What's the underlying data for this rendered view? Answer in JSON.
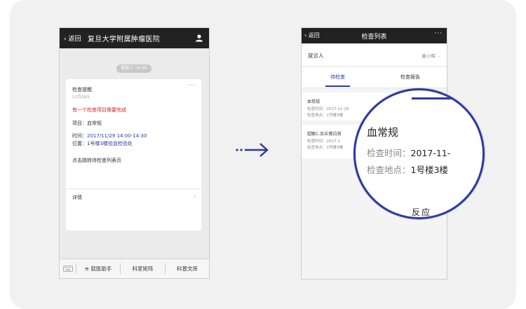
{
  "colors": {
    "accent": "#2d3a9b",
    "alert": "#e02020",
    "header": "#222222"
  },
  "phone1": {
    "header": {
      "back_label": "返回",
      "title": "复旦大学附属肿瘤医院",
      "user_icon": "user-icon"
    },
    "date_badge": "星期三 19:30",
    "message": {
      "title": "检查提醒",
      "date": "11月29日",
      "alert": "有一个检查项目需要完成",
      "item_label": "项目：",
      "item_value": "血常规",
      "time_label": "时间：",
      "time_value": "2017/11/29  14:00-14:30",
      "place_label": "位置：",
      "place_value": "1号楼3楼验血检验处",
      "hint": "点击跳转待检查列表页",
      "detail_label": "详情"
    },
    "bottom_tabs": [
      "就医助手",
      "科室矩阵",
      "科普文库"
    ]
  },
  "phone2": {
    "header": {
      "back_label": "返回",
      "title": "检查列表"
    },
    "patient_label": "就诊人",
    "patient_name": "秦小辉",
    "tabs": [
      "待检查",
      "检查报告"
    ],
    "items": [
      {
        "name": "血常规",
        "time": "检查时间：2017-11-29",
        "place": "检查地点：1号楼3楼"
      },
      {
        "name": "超敏C-反应蛋白测",
        "time": "检查时间：2017-1",
        "place": "检查地点：1号楼3楼"
      }
    ]
  },
  "magnifier": {
    "title": "血常规",
    "time_label": "检查时间：",
    "time_value": "2017-11-",
    "place_label": "检查地点：",
    "place_value": "1号楼3楼",
    "next_fragment": "反应"
  }
}
